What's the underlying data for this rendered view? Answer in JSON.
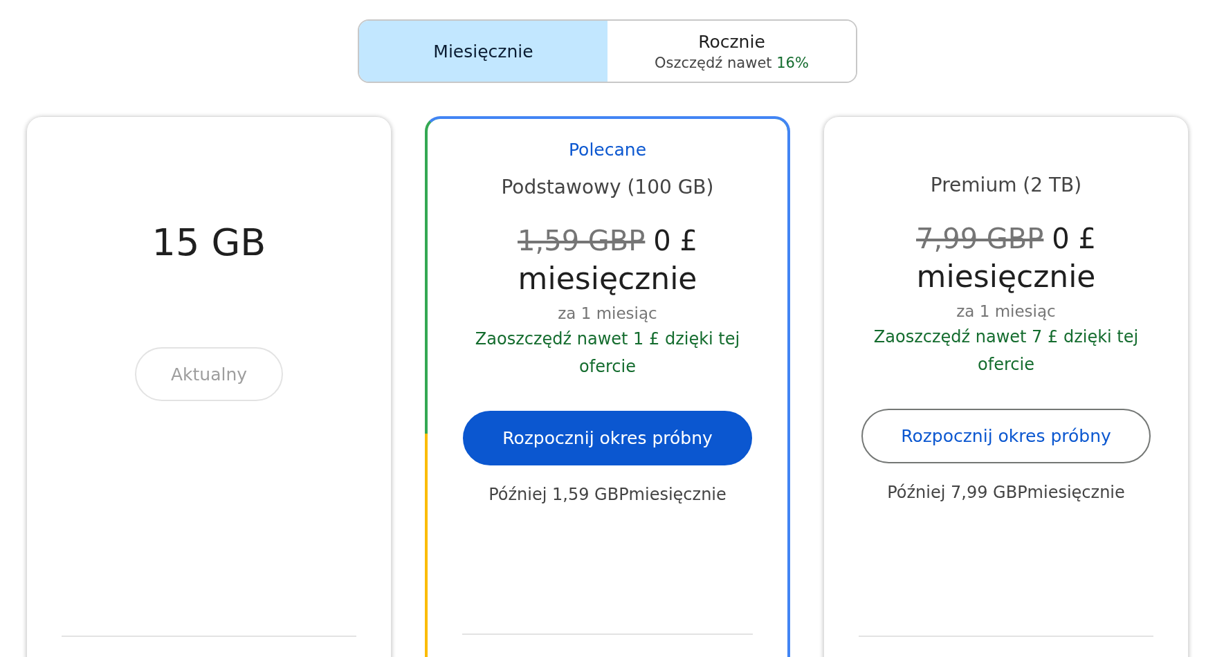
{
  "billing_toggle": [
    {
      "label": "Miesięcznie",
      "selected": true
    },
    {
      "label": "Rocznie",
      "selected": false,
      "note": "Oszczędź nawet",
      "discount": "16%"
    }
  ],
  "plans": [
    {
      "kind": "current",
      "recommended": false,
      "storage": "15 GB",
      "button": "Aktualny"
    },
    {
      "kind": "trial",
      "recommended": true,
      "badge": "Polecane",
      "title": "Podstawowy (100 GB)",
      "old_price": "1,59 GBP",
      "price": "0 £",
      "period": "miesięcznie",
      "duration": "za 1 miesiąc",
      "savings": "Zaoszczędź nawet 1 £ dzięki tej ofercie",
      "button": "Rozpocznij okres próbny",
      "later": "Później 1,59 GBPmiesięcznie"
    },
    {
      "kind": "trial",
      "recommended": false,
      "title": "Premium (2 TB)",
      "old_price": "7,99 GBP",
      "price": "0 £",
      "period": "miesięcznie",
      "duration": "za 1 miesiąc",
      "savings": "Zaoszczędź nawet 7 £ dzięki tej ofercie",
      "button": "Rozpocznij okres próbny",
      "later": "Później 7,99 GBPmiesięcznie"
    }
  ]
}
